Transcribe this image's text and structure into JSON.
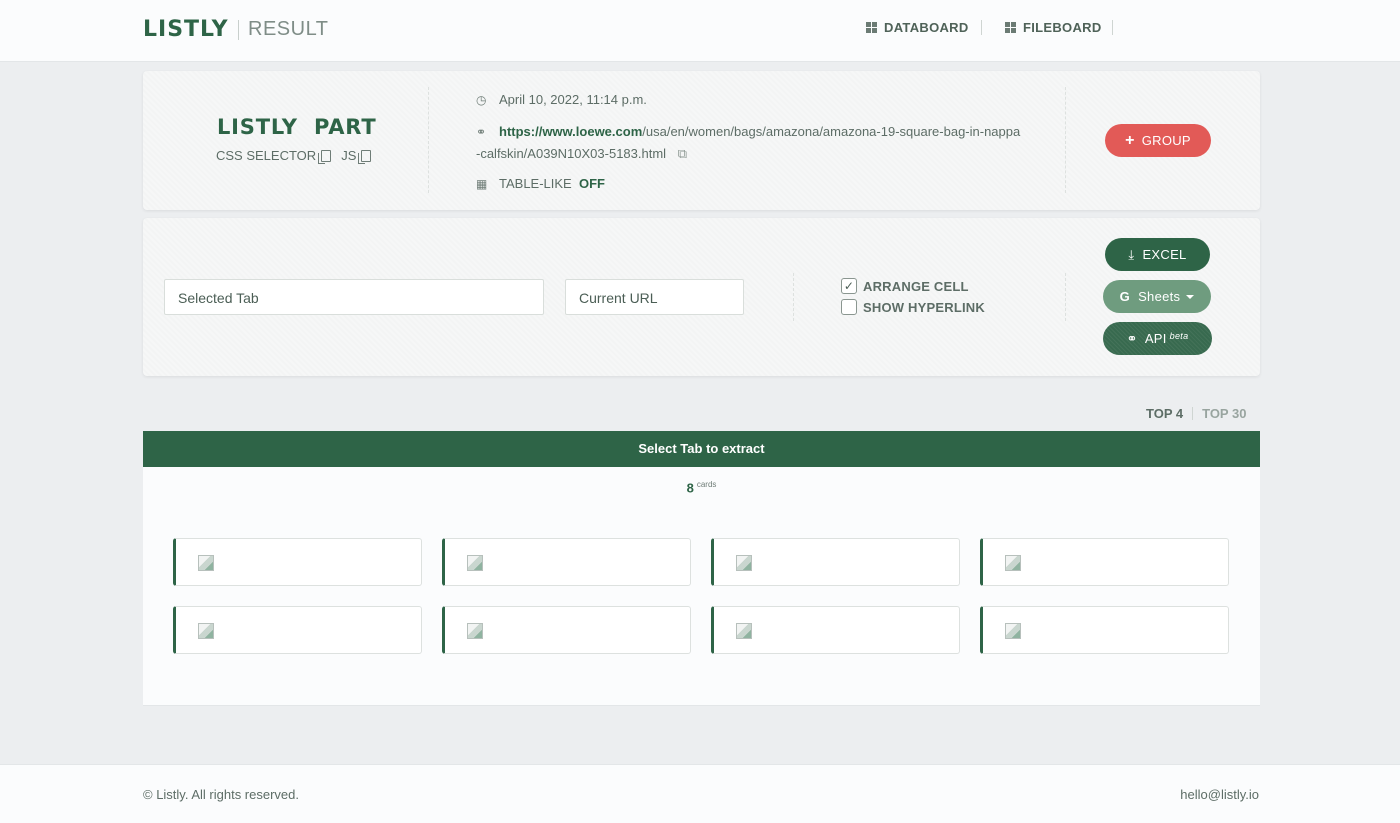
{
  "brand": {
    "logo": "LISTLY",
    "page": "RESULT"
  },
  "nav": {
    "items": [
      {
        "label": "DATABOARD",
        "icon": "grid-icon"
      },
      {
        "label": "FILEBOARD",
        "icon": "grid-icon"
      }
    ]
  },
  "summary": {
    "title": "LISTLY  PART",
    "css_selector_label": "CSS SELECTOR",
    "js_label": "JS",
    "date": "April 10, 2022, 11:14 p.m.",
    "url_host": "https://www.loewe.com",
    "url_path": "/usa/en/women/bags/amazona/amazona-19-square-bag-in-nappa-calfskin/A039N10X03-5183.html",
    "table_like_label": "TABLE-LIKE",
    "table_like_value": "OFF",
    "group_button": "GROUP"
  },
  "controls": {
    "selected_tab_value": "Selected Tab",
    "current_url_value": "Current URL",
    "arrange_cell_label": "ARRANGE CELL",
    "arrange_cell_checked": true,
    "show_hyperlink_label": "SHOW HYPERLINK",
    "show_hyperlink_checked": false,
    "excel_button": "EXCEL",
    "sheets_button": "Sheets",
    "api_button": "API",
    "api_badge": "beta"
  },
  "view_tabs": {
    "active": "TOP 4",
    "inactive": "TOP 30"
  },
  "result": {
    "header": "Select Tab to extract",
    "count": "8",
    "count_unit": "cards",
    "cards": [
      {
        "icon": "broken-image-icon"
      },
      {
        "icon": "broken-image-icon"
      },
      {
        "icon": "broken-image-icon"
      },
      {
        "icon": "broken-image-icon"
      },
      {
        "icon": "broken-image-icon"
      },
      {
        "icon": "broken-image-icon"
      },
      {
        "icon": "broken-image-icon"
      },
      {
        "icon": "broken-image-icon"
      }
    ]
  },
  "footer": {
    "copyright": "© Listly. All rights reserved.",
    "email": "hello@listly.io"
  },
  "colors": {
    "brand_green": "#2e6447",
    "group_red": "#e25a57",
    "sheets_green": "#6f9c7f"
  }
}
